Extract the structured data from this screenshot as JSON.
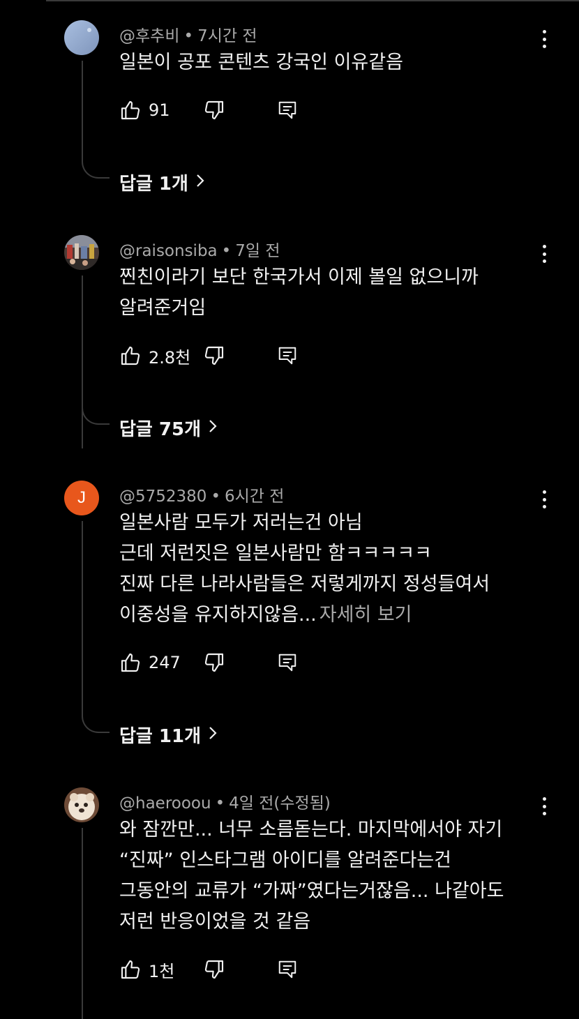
{
  "comments": [
    {
      "author": "@후추비",
      "time": "7시간 전",
      "avatar_color": "#8fa6c9",
      "lines": [
        "일본이 공포 콘텐츠 강국인 이유같음"
      ],
      "read_more": "",
      "likes": "91",
      "replies": "답글 1개"
    },
    {
      "author": "@raisonsiba",
      "time": "7일 전",
      "avatar_color": "#5b4a44",
      "lines": [
        "찐친이라기 보단 한국가서 이제 볼일 없으니까",
        "알려준거임"
      ],
      "read_more": "",
      "likes": "2.8천",
      "replies": "답글 75개"
    },
    {
      "author": "@5752380",
      "time": "6시간 전",
      "avatar_letter": "J",
      "avatar_color": "#e8571c",
      "lines": [
        "일본사람 모두가 저러는건 아님",
        "근데 저런짓은 일본사람만 함ㅋㅋㅋㅋㅋ",
        "진짜 다른 나라사람들은 저렇게까지 정성들여서",
        "이중성을 유지하지않음..."
      ],
      "read_more": "자세히 보기",
      "likes": "247",
      "replies": "답글 11개"
    },
    {
      "author": "@haerooou",
      "time": "4일 전(수정됨)",
      "avatar_color": "#c9a184",
      "lines": [
        "와 잠깐만... 너무 소름돋는다. 마지막에서야 자기",
        "“진짜” 인스타그램 아이디를 알려준다는건",
        "그동안의 교류가 “가짜”였다는거잖음... 나같아도",
        "저런 반응이었을 것 같음"
      ],
      "read_more": "",
      "likes": "1천",
      "replies": ""
    }
  ],
  "icons": {
    "like": "thumbs-up-icon",
    "dislike": "thumbs-down-icon",
    "reply": "reply-icon",
    "more": "more-vertical-icon",
    "chevron": "chevron-right-icon"
  }
}
